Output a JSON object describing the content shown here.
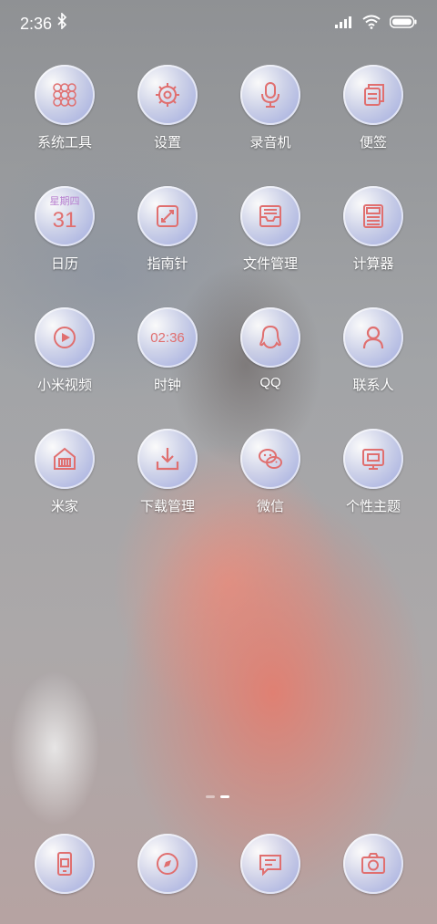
{
  "status": {
    "time": "2:36"
  },
  "grid": [
    {
      "label": "系统工具",
      "icon": "tools-folder-icon"
    },
    {
      "label": "设置",
      "icon": "gear-icon"
    },
    {
      "label": "录音机",
      "icon": "microphone-icon"
    },
    {
      "label": "便签",
      "icon": "notes-icon"
    },
    {
      "label": "日历",
      "icon": "calendar-icon",
      "cal_weekday": "星期四",
      "cal_day": "31"
    },
    {
      "label": "指南针",
      "icon": "compass-icon"
    },
    {
      "label": "文件管理",
      "icon": "file-manager-icon"
    },
    {
      "label": "计算器",
      "icon": "calculator-icon"
    },
    {
      "label": "小米视频",
      "icon": "video-icon"
    },
    {
      "label": "时钟",
      "icon": "clock-icon",
      "clock_text": "02:36"
    },
    {
      "label": "QQ",
      "icon": "qq-icon"
    },
    {
      "label": "联系人",
      "icon": "contacts-icon"
    },
    {
      "label": "米家",
      "icon": "mihome-icon"
    },
    {
      "label": "下载管理",
      "icon": "download-icon"
    },
    {
      "label": "微信",
      "icon": "wechat-icon"
    },
    {
      "label": "个性主题",
      "icon": "themes-icon"
    }
  ],
  "dock": [
    {
      "icon": "phone-icon"
    },
    {
      "icon": "browser-icon"
    },
    {
      "icon": "messages-icon"
    },
    {
      "icon": "camera-icon"
    }
  ],
  "colors": {
    "icon_stroke": "#e06f6f",
    "label": "#ffffff"
  }
}
